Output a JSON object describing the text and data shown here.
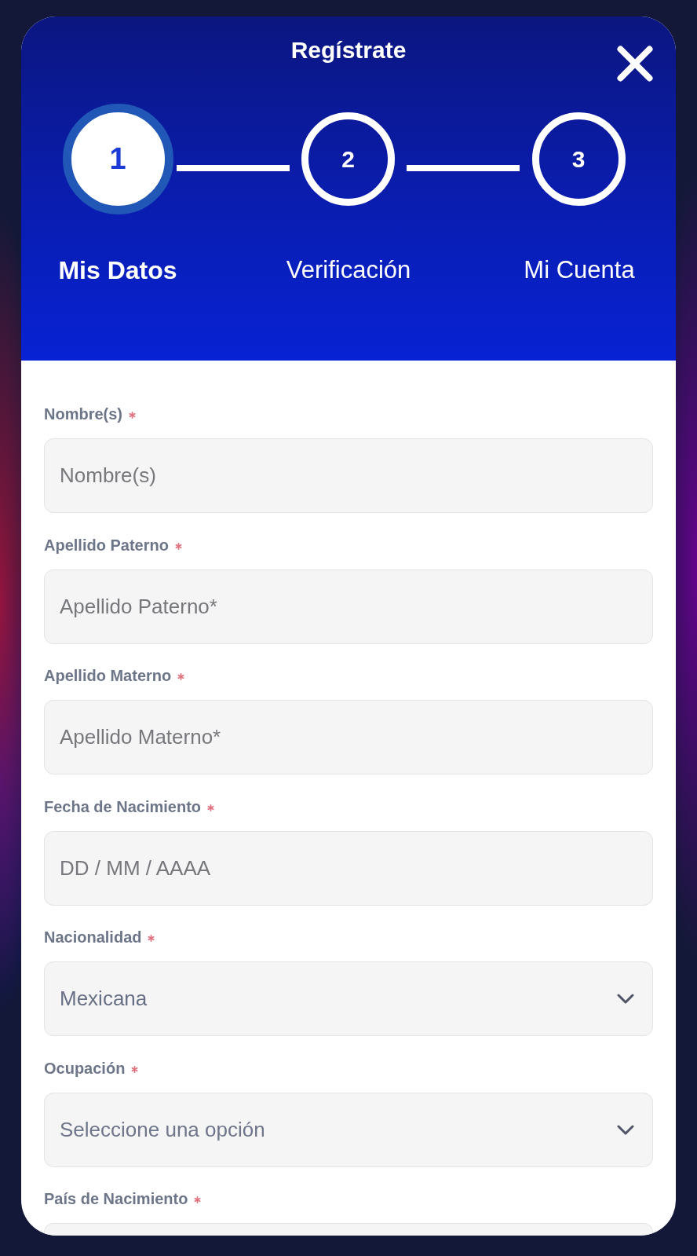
{
  "dialog": {
    "title": "Regístrate"
  },
  "steps": [
    {
      "number": "1",
      "label": "Mis Datos",
      "selected": true
    },
    {
      "number": "2",
      "label": "Verificación",
      "selected": false
    },
    {
      "number": "3",
      "label": "Mi Cuenta",
      "selected": false
    }
  ],
  "form": {
    "fields": [
      {
        "kind": "text",
        "label": "Nombre(s)",
        "required": true,
        "placeholder": "Nombre(s)"
      },
      {
        "kind": "text",
        "label": "Apellido Paterno",
        "required": true,
        "placeholder": "Apellido Paterno*"
      },
      {
        "kind": "text",
        "label": "Apellido Materno",
        "required": true,
        "placeholder": "Apellido Materno*"
      },
      {
        "kind": "text",
        "label": "Fecha de Nacimiento",
        "required": true,
        "placeholder": "DD / MM / AAAA"
      },
      {
        "kind": "select",
        "label": "Nacionalidad",
        "required": true,
        "value": "Mexicana"
      },
      {
        "kind": "select",
        "label": "Ocupación",
        "required": true,
        "placeholder": "Seleccione una opción"
      },
      {
        "kind": "text",
        "label": "País de Nacimiento",
        "required": true
      }
    ]
  }
}
